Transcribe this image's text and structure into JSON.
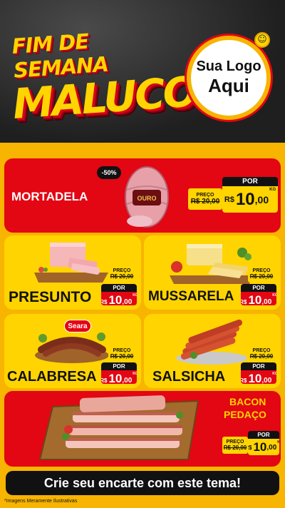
{
  "header": {
    "title_line1": "Fim de Semana",
    "title_line2": "Maluco",
    "logo_line1": "Sua Logo",
    "logo_line2": "Aqui"
  },
  "mortadela": {
    "name": "MORTADELA",
    "discount": "-50%",
    "brand": "OURO",
    "old_label": "PREÇO",
    "old_price": "R$ 20,00",
    "new_label": "POR",
    "currency": "R$",
    "price_int": "10",
    "price_dec": ",00",
    "unit": "KG"
  },
  "presunto": {
    "name": "PRESUNTO",
    "old_label": "PREÇO",
    "old_price": "R$ 20,00",
    "new_label": "POR",
    "currency": "R$",
    "price_int": "10",
    "price_dec": ",00",
    "unit": "KG"
  },
  "mussarela": {
    "name": "MUSSARELA",
    "old_label": "PREÇO",
    "old_price": "R$ 20,00",
    "new_label": "POR",
    "currency": "R$",
    "price_int": "10",
    "price_dec": ",00",
    "unit": "KG"
  },
  "calabresa": {
    "name": "CALABRESA",
    "brand": "Seara",
    "old_label": "PREÇO",
    "old_price": "R$ 20,00",
    "new_label": "POR",
    "currency": "R$",
    "price_int": "10",
    "price_dec": ",00",
    "unit": "KG"
  },
  "salsicha": {
    "name": "SALSICHA",
    "old_label": "PREÇO",
    "old_price": "R$ 20,00",
    "new_label": "POR",
    "currency": "R$",
    "price_int": "10",
    "price_dec": ",00",
    "unit": "KG"
  },
  "bacon": {
    "name_line1": "BACON",
    "name_line2": "PEDAÇO",
    "old_label": "PREÇO",
    "old_price": "R$ 20,00",
    "new_label": "POR",
    "currency": "R$",
    "price_int": "10",
    "price_dec": ",00",
    "unit": "KG"
  },
  "footer": {
    "cta": "Crie seu encarte com este tema!",
    "disclaimer": "*Imagens Meramente Ilustrativas"
  },
  "colors": {
    "red": "#e30613",
    "yellow": "#ffd400",
    "dark": "#111111"
  }
}
